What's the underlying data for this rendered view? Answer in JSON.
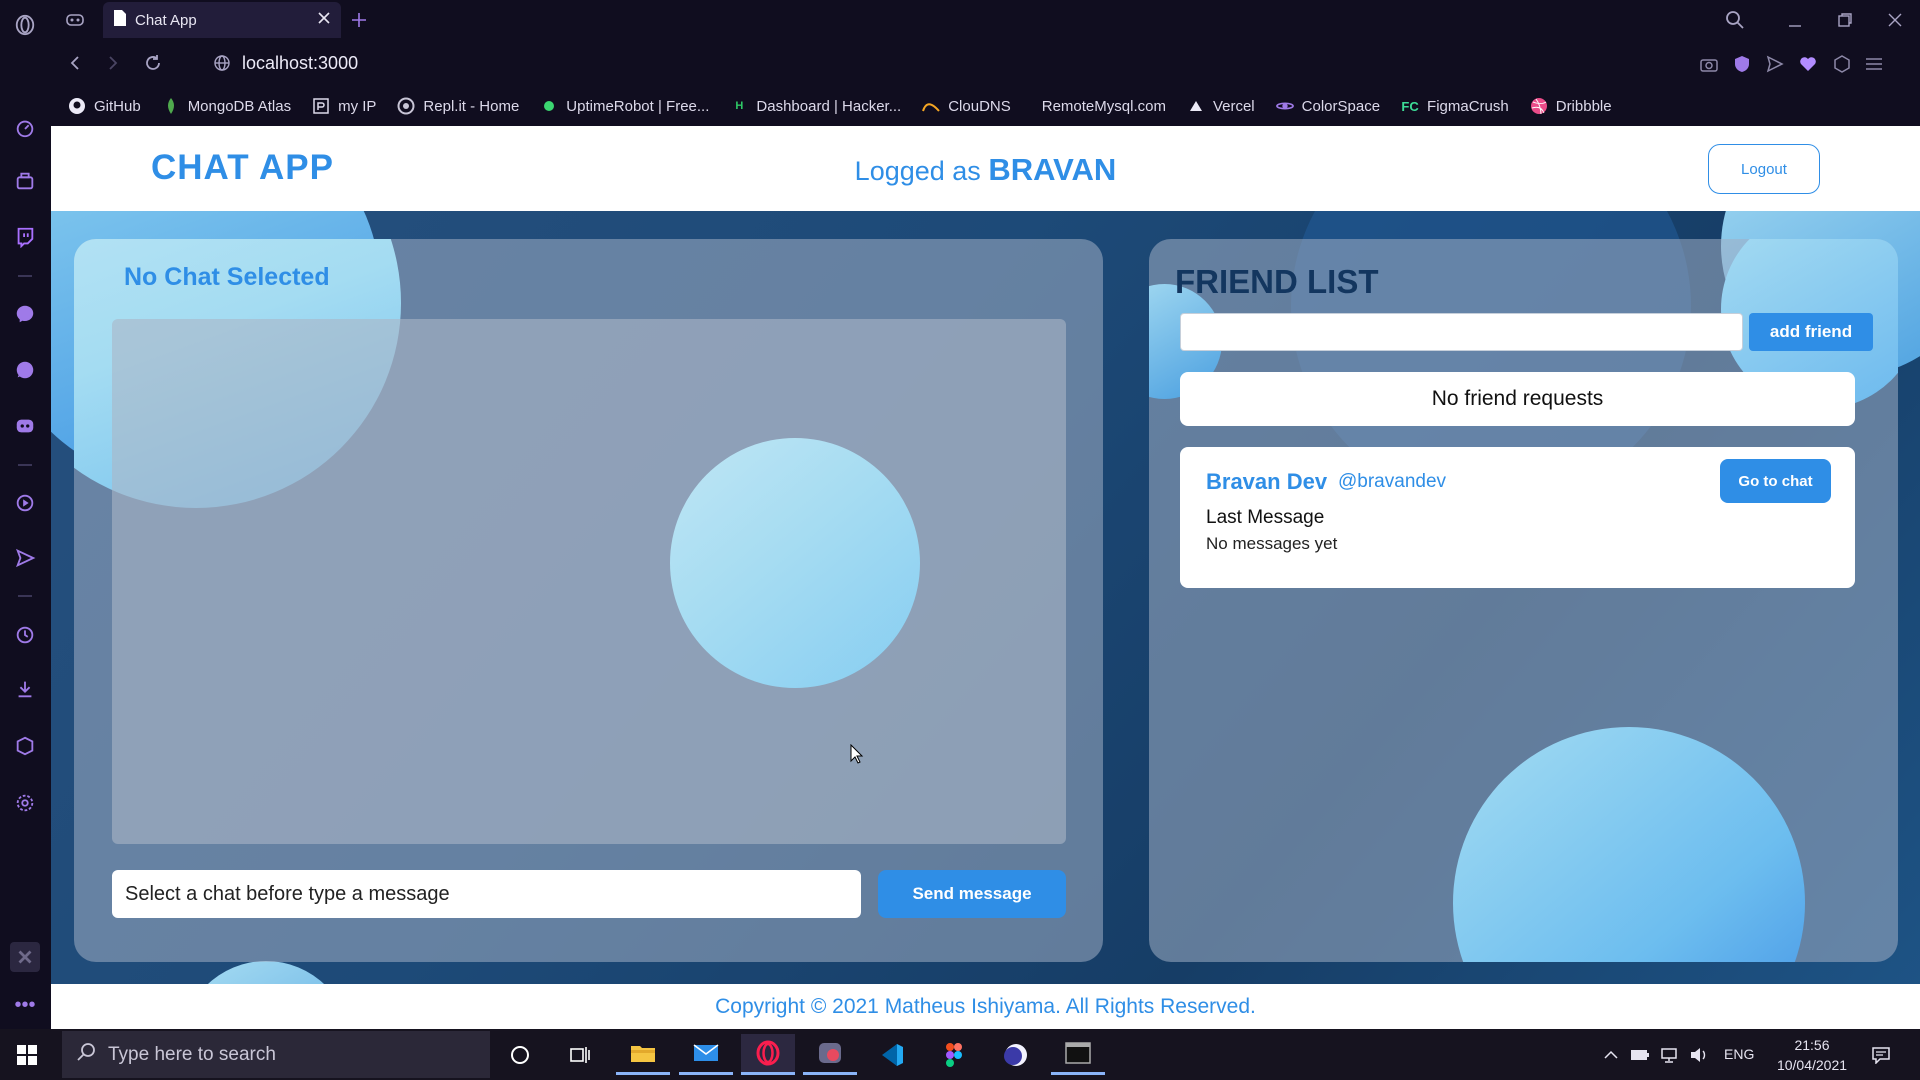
{
  "browser": {
    "tab_title": "Chat App",
    "url": "localhost:3000",
    "bookmarks": [
      {
        "label": "GitHub",
        "icon": "github-icon"
      },
      {
        "label": "MongoDB Atlas",
        "icon": "mongodb-leaf-icon"
      },
      {
        "label": "my IP",
        "icon": "ip-icon"
      },
      {
        "label": "Repl.it - Home",
        "icon": "replit-icon"
      },
      {
        "label": "UptimeRobot | Free...",
        "icon": "uptimerobot-icon"
      },
      {
        "label": "Dashboard | Hacker...",
        "icon": "hackerrank-icon"
      },
      {
        "label": "ClouDNS",
        "icon": "cloudns-icon"
      },
      {
        "label": "RemoteMysql.com",
        "icon": ""
      },
      {
        "label": "Vercel",
        "icon": "vercel-triangle-icon"
      },
      {
        "label": "ColorSpace",
        "icon": "colorspace-icon"
      },
      {
        "label": "FigmaCrush",
        "icon": "figmacrush-icon"
      },
      {
        "label": "Dribbble",
        "icon": "dribbble-icon"
      }
    ]
  },
  "app": {
    "brand": "CHAT APP",
    "logged_prefix": "Logged as",
    "username": "BRAVAN",
    "logout_label": "Logout",
    "chat": {
      "title": "No Chat Selected",
      "input_placeholder": "Select a chat before type a message",
      "send_label": "Send message"
    },
    "friends": {
      "title": "FRIEND LIST",
      "add_label": "add friend",
      "add_input_value": "",
      "no_requests": "No friend requests",
      "list": [
        {
          "name": "Bravan Dev",
          "handle": "@bravandev",
          "last_message_label": "Last Message",
          "last_message": "No messages yet",
          "go_label": "Go to chat"
        }
      ]
    },
    "footer": "Copyright © 2021 Matheus Ishiyama. All Rights Reserved."
  },
  "taskbar": {
    "search_placeholder": "Type here to search",
    "language": "ENG",
    "time": "21:56",
    "date": "10/04/2021"
  },
  "colors": {
    "accent": "#2f8ee6",
    "friend_title": "#13365f",
    "opera_sidebar": "#100d1f"
  }
}
